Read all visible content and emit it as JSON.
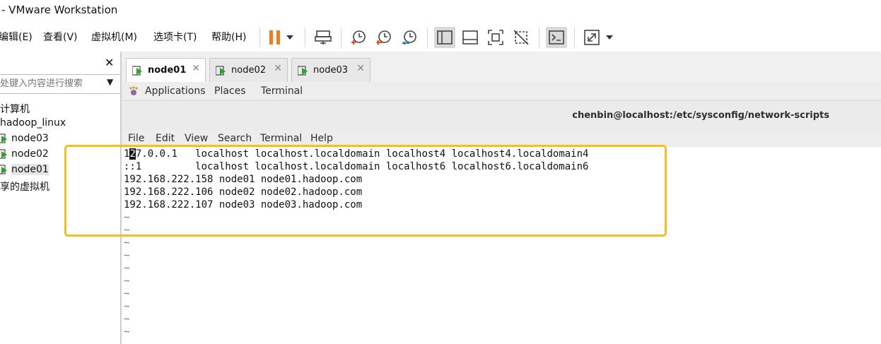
{
  "window": {
    "title": "- VMware Workstation"
  },
  "menu": [
    {
      "label": "编辑(E)"
    },
    {
      "label": "查看(V)"
    },
    {
      "label": "虚拟机(M)"
    },
    {
      "label": "选项卡(T)"
    },
    {
      "label": "帮助(H)"
    }
  ],
  "toolbar": {
    "icons": [
      "pause-icon",
      "dropdown-icon",
      "send-keys-icon",
      "snapshot-icon",
      "revert-snapshot-icon",
      "snapshot-manager-icon",
      "library-view-icon",
      "thumbnail-bar-icon",
      "fullscreen-fit-icon",
      "unity-icon",
      "console-view-icon",
      "stretch-icon",
      "dropdown-icon"
    ],
    "accent": "#f07d1a"
  },
  "library": {
    "search_placeholder": "在此处键入内容进行搜索",
    "search_placeholder_visible": "处键入内容进行搜索",
    "items": [
      {
        "label": "计算机"
      },
      {
        "label": "hadoop_linux"
      },
      {
        "label": "node03"
      },
      {
        "label": "node02"
      },
      {
        "label": "node01"
      },
      {
        "label": "享的虚拟机"
      }
    ]
  },
  "tabs": [
    {
      "label": "node01",
      "active": true
    },
    {
      "label": "node02",
      "active": false
    },
    {
      "label": "node03",
      "active": false
    }
  ],
  "gnome": {
    "applications": "Applications",
    "places": "Places",
    "terminal": "Terminal"
  },
  "terminal": {
    "title": "chenbin@localhost:/etc/sysconfig/network-scripts",
    "menu": [
      "File",
      "Edit",
      "View",
      "Search",
      "Terminal",
      "Help"
    ],
    "lines": [
      {
        "text": "127.0.0.1   localhost localhost.localdomain localhost4 localhost4.localdomain4"
      },
      {
        "text": "::1         localhost localhost.localdomain localhost6 localhost6.localdomain6"
      },
      {
        "text": "192.168.222.158 node01 node01.hadoop.com"
      },
      {
        "text": "192.168.222.106 node02 node02.hadoop.com"
      },
      {
        "text": "192.168.222.107 node03 node03.hadoop.com"
      }
    ],
    "first_line_prefix": "1",
    "first_line_cursor": "2",
    "first_line_rest": "7.0.0.1   localhost localhost.localdomain localhost4 localhost4.localdomain4",
    "tilde": "~",
    "tilde_color": "#4a7ec2"
  },
  "highlight_color": "#f5bd1f"
}
